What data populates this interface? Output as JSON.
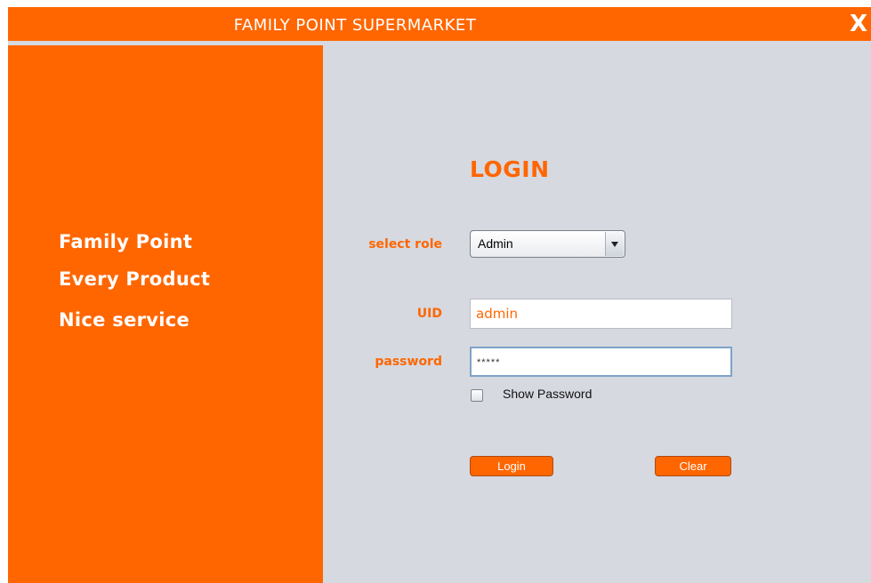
{
  "window": {
    "title": "FAMILY POINT SUPERMARKET",
    "close_label": "X"
  },
  "left_panel": {
    "taglines": [
      "Family Point",
      "Every Product",
      "Nice service"
    ]
  },
  "form": {
    "heading": "LOGIN",
    "role_label": "select role",
    "role_value": "Admin",
    "uid_label": "UID",
    "uid_value": "admin",
    "password_label": "password",
    "password_value": "*****",
    "show_password_label": "Show Password",
    "show_password_checked": false,
    "login_button": "Login",
    "clear_button": "Clear"
  },
  "colors": {
    "accent": "#ff6600",
    "background": "#d6d9e0"
  }
}
